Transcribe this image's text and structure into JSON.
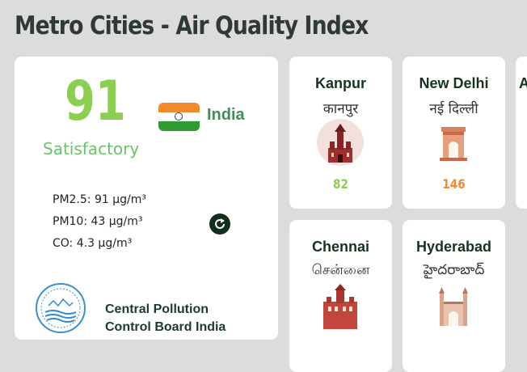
{
  "page": {
    "title": "Metro Cities - Air Quality Index"
  },
  "main": {
    "aqi": "91",
    "status": "Satisfactory",
    "status_color": "#6cc26a",
    "aqi_color": "#8bcf4e",
    "country": "India",
    "flag_icon": "india-flag-icon",
    "pollutants": [
      {
        "label": "PM2.5: 91 µg/m³"
      },
      {
        "label": "PM10: 43 µg/m³"
      },
      {
        "label": "CO: 4.3 µg/m³"
      }
    ],
    "refresh_icon": "refresh-icon",
    "source": {
      "name": "Central Pollution Control Board India",
      "logo_icon": "cpcb-logo-icon"
    }
  },
  "cities": [
    {
      "name": "Kanpur",
      "local": "कानपुर",
      "aqi": "82",
      "aqi_color": "#8bcf4e",
      "icon": "kanpur-monument-icon"
    },
    {
      "name": "New Delhi",
      "local": "नई दिल्ली",
      "aqi": "146",
      "aqi_color": "#f08a2b",
      "icon": "india-gate-icon"
    },
    {
      "name": "Chennai",
      "local": "சென்னை",
      "icon": "chennai-central-icon"
    },
    {
      "name": "Hyderabad",
      "local": "హైదరాబాద్",
      "icon": "charminar-icon"
    },
    {
      "name": "A"
    }
  ]
}
